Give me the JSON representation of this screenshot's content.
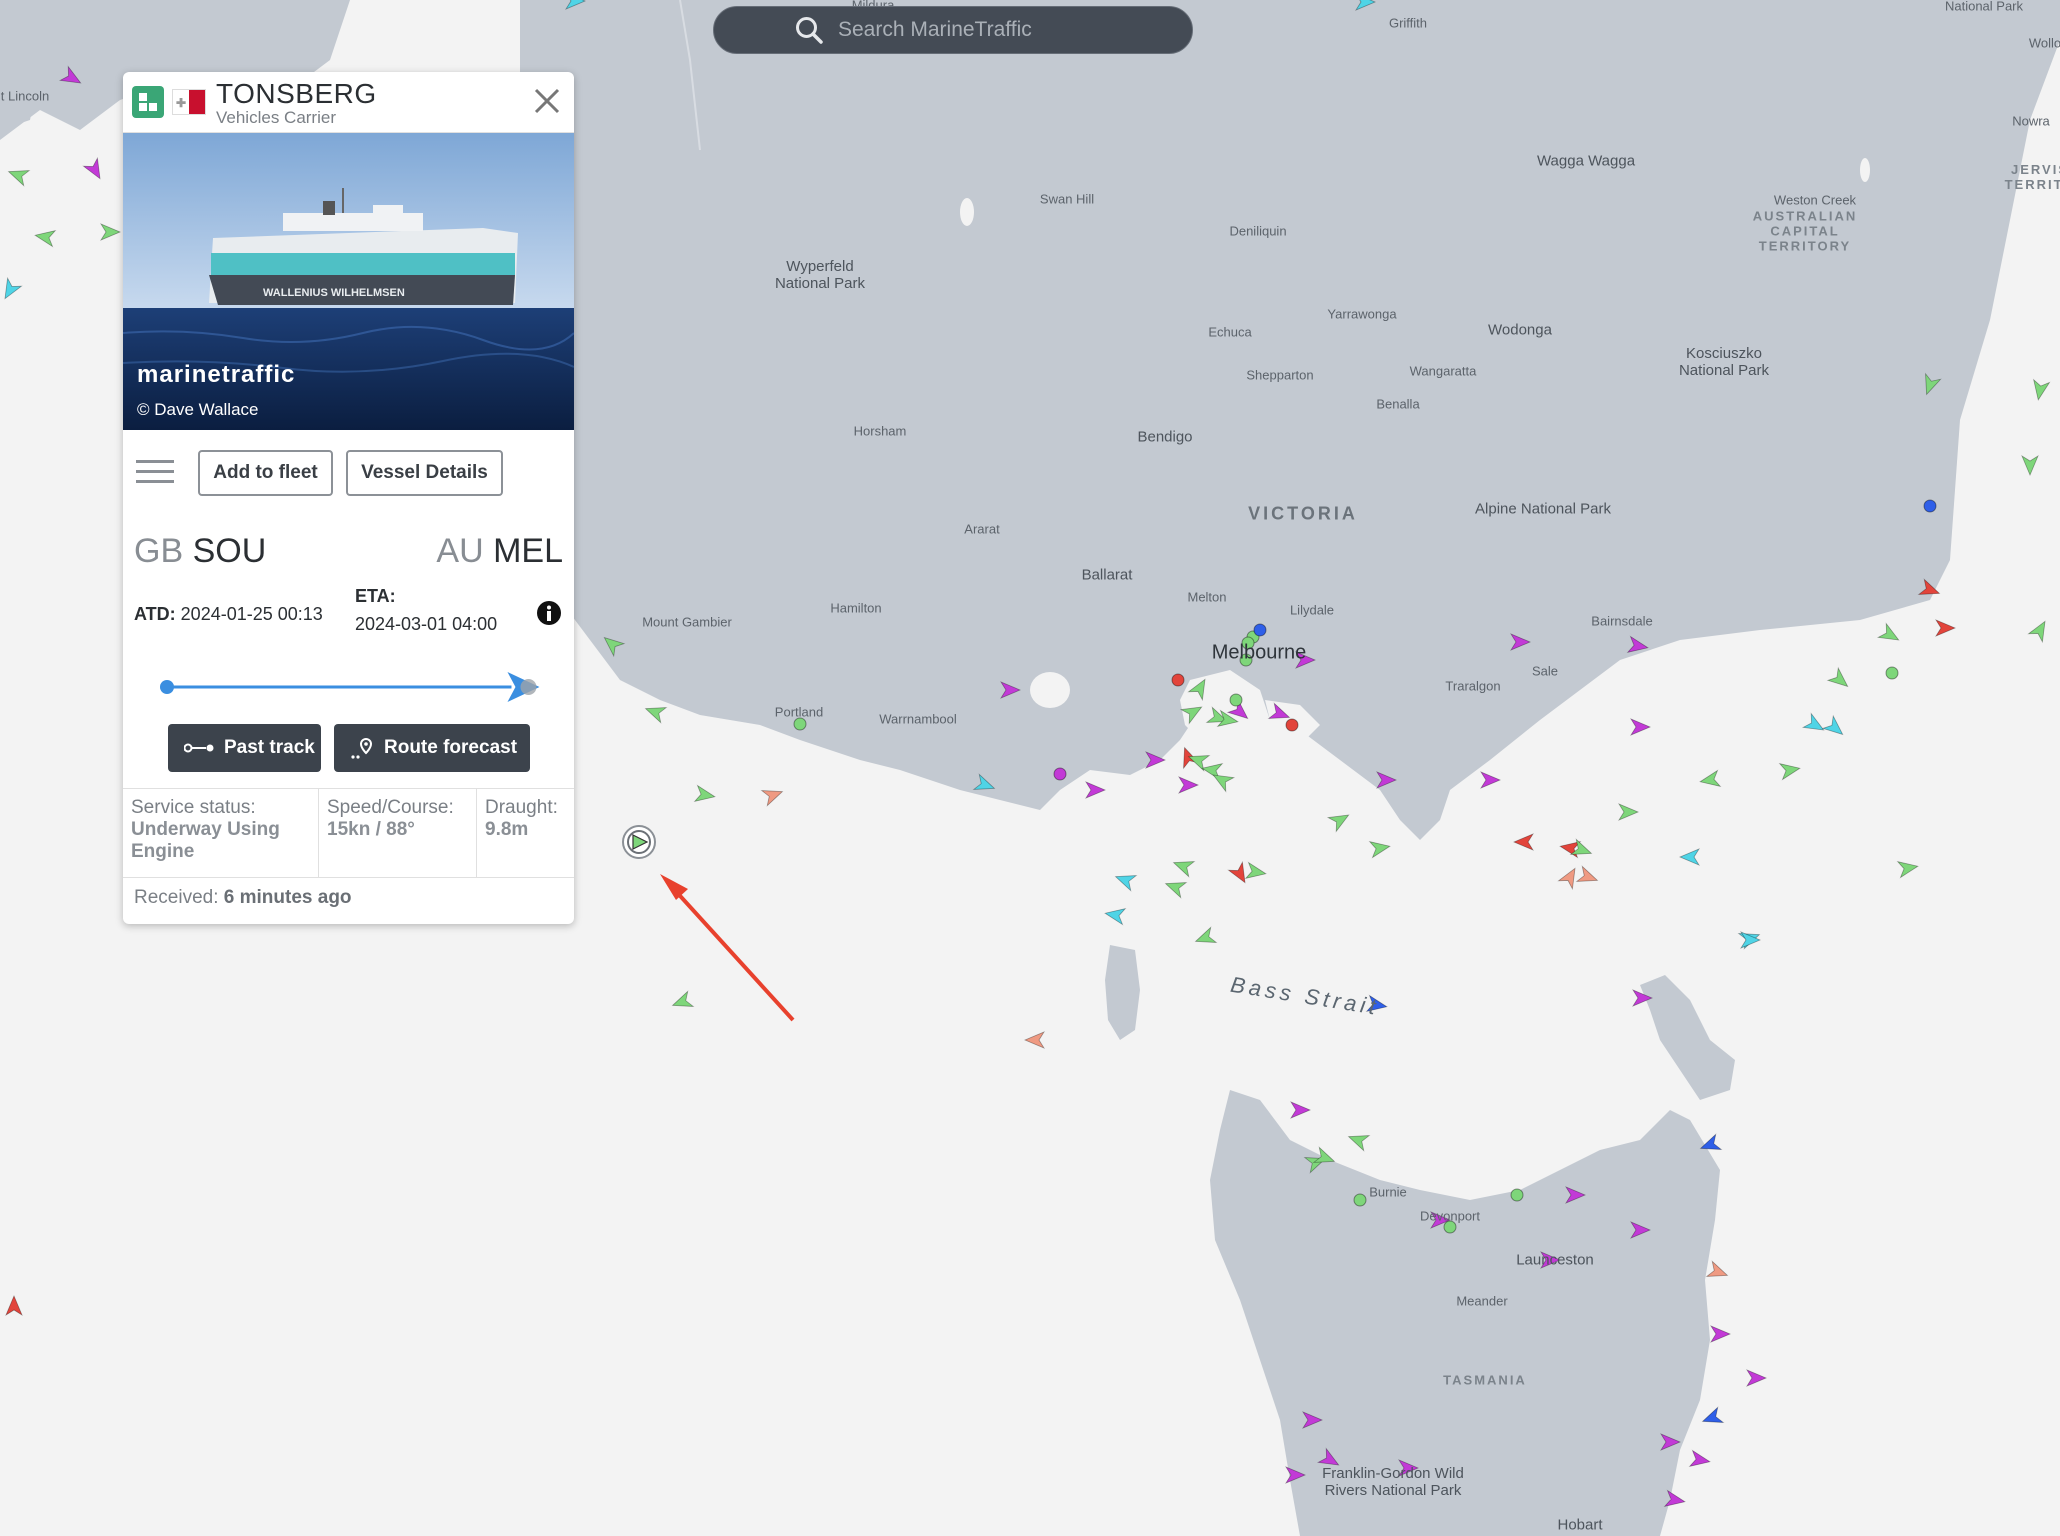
{
  "search": {
    "placeholder": "Search MarineTraffic",
    "icon": "search-icon"
  },
  "map": {
    "places": [
      {
        "label": "Mildura",
        "cls": "small"
      },
      {
        "label": "Griffith",
        "cls": "small"
      },
      {
        "label": "National Park",
        "cls": "small"
      },
      {
        "label": "Wollo",
        "cls": "small"
      },
      {
        "label": "Nowra",
        "cls": "small"
      },
      {
        "label": "t Lincoln",
        "cls": "small"
      },
      {
        "label": "Wagga Wagga",
        "cls": ""
      },
      {
        "label": "Swan Hill",
        "cls": "small"
      },
      {
        "label": "Deniliquin",
        "cls": "small"
      },
      {
        "label": "Weston Creek",
        "cls": "small"
      },
      {
        "label": "AUSTRALIAN\nCAPITAL\nTERRITORY",
        "cls": "region-sm"
      },
      {
        "label": "JERVIS\nTERRITO",
        "cls": "region-sm"
      },
      {
        "label": "Wyperfeld\nNational Park",
        "cls": ""
      },
      {
        "label": "Yarrawonga",
        "cls": "small"
      },
      {
        "label": "Wodonga",
        "cls": ""
      },
      {
        "label": "Echuca",
        "cls": "small"
      },
      {
        "label": "Kosciuszko\nNational Park",
        "cls": ""
      },
      {
        "label": "Shepparton",
        "cls": "small"
      },
      {
        "label": "Wangaratta",
        "cls": "small"
      },
      {
        "label": "Benalla",
        "cls": "small"
      },
      {
        "label": "Horsham",
        "cls": "small"
      },
      {
        "label": "Bendigo",
        "cls": ""
      },
      {
        "label": "VICTORIA",
        "cls": "region"
      },
      {
        "label": "Alpine National Park",
        "cls": ""
      },
      {
        "label": "Ararat",
        "cls": "small"
      },
      {
        "label": "Ballarat",
        "cls": ""
      },
      {
        "label": "Melton",
        "cls": "small"
      },
      {
        "label": "Lilydale",
        "cls": "small"
      },
      {
        "label": "Mount Gambier",
        "cls": "small"
      },
      {
        "label": "Hamilton",
        "cls": "small"
      },
      {
        "label": "Melbourne",
        "cls": "city"
      },
      {
        "label": "Bairnsdale",
        "cls": "small"
      },
      {
        "label": "Sale",
        "cls": "small"
      },
      {
        "label": "Traralgon",
        "cls": "small"
      },
      {
        "label": "Portland",
        "cls": "small"
      },
      {
        "label": "Warrnambool",
        "cls": "small"
      },
      {
        "label": "Bass Strait",
        "cls": "sea"
      },
      {
        "label": "Burnie",
        "cls": "small"
      },
      {
        "label": "Devonport",
        "cls": "small"
      },
      {
        "label": "Launceston",
        "cls": ""
      },
      {
        "label": "Meander",
        "cls": "small"
      },
      {
        "label": "TASMANIA",
        "cls": "region-sm"
      },
      {
        "label": "Franklin-Gordon Wild\nRivers National Park",
        "cls": ""
      },
      {
        "label": "Hobart",
        "cls": ""
      }
    ],
    "colors": {
      "land": "#c3c9d1",
      "sea": "#f3f3f3",
      "cargo": "#7ed67a",
      "passenger": "#2f5fe8",
      "tanker": "#e2443b",
      "pleasure": "#c23ad6",
      "fishing": "#ef9a82",
      "tug": "#4fd4e6",
      "arrow": "#e8412d"
    }
  },
  "vessel": {
    "name": "TONSBERG",
    "type": "Vehicles Carrier",
    "type_icon": "vehicles-carrier-icon",
    "flag": "malta-flag-icon",
    "photo_watermark": "marinetraffic",
    "photo_credit": "© Dave Wallace",
    "photo_hull_text": "WALLENIUS WILHELMSEN",
    "add_to_fleet": "Add to fleet",
    "vessel_details": "Vessel Details",
    "departure": {
      "country": "GB",
      "port": "SOU"
    },
    "arrival": {
      "country": "AU",
      "port": "MEL"
    },
    "atd_label": "ATD:",
    "atd_value": "2024-01-25 00:13",
    "eta_label": "ETA:",
    "eta_value": "2024-03-01 04:00",
    "progress": 0.88,
    "past_track": "Past track",
    "route_forecast": "Route forecast",
    "service_status_label": "Service status:",
    "service_status_value": "Underway Using Engine",
    "speed_course_label": "Speed/Course:",
    "speed_course_value": "15kn / 88°",
    "draught_label": "Draught:",
    "draught_value": "9.8m",
    "received_label": "Received:",
    "received_value": "6 minutes ago"
  }
}
